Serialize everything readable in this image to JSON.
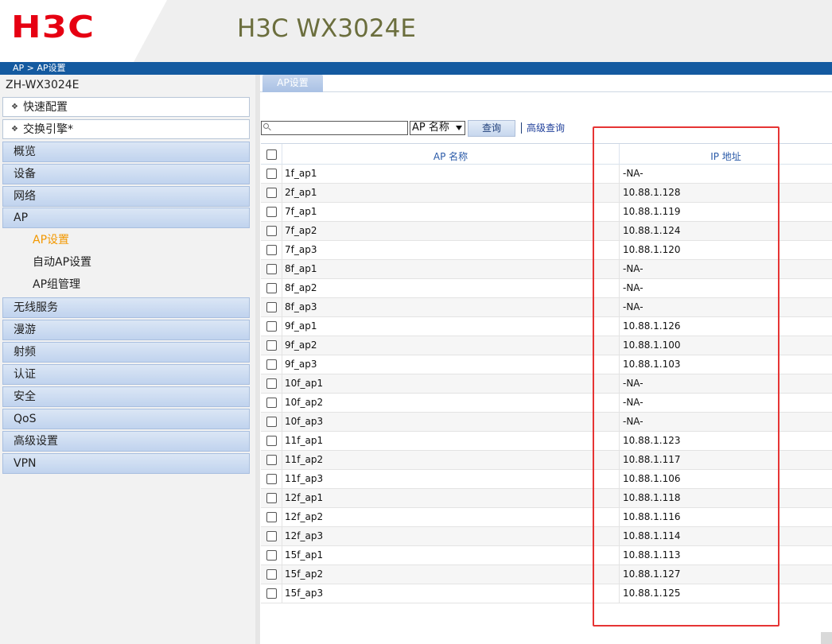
{
  "header": {
    "logo_text": "H3C",
    "product_title": "H3C WX3024E",
    "brand_color": "#e60012"
  },
  "breadcrumb": "AP > AP设置",
  "sidebar": {
    "device_name": "ZH-WX3024E",
    "quick_items": [
      "快速配置",
      "交换引擎*"
    ],
    "nav_group_top": [
      "概览",
      "设备",
      "网络",
      "AP"
    ],
    "ap_subitems": [
      {
        "label": "AP设置",
        "active": true
      },
      {
        "label": "自动AP设置",
        "active": false
      },
      {
        "label": "AP组管理",
        "active": false
      }
    ],
    "nav_group_bottom": [
      "无线服务",
      "漫游",
      "射频",
      "认证",
      "安全",
      "QoS",
      "高级设置",
      "VPN"
    ]
  },
  "tab": {
    "label": "AP设置"
  },
  "search": {
    "placeholder": "",
    "field_select": "AP 名称",
    "query_button": "查询",
    "advanced_link": "高级查询"
  },
  "table": {
    "columns": [
      "AP 名称",
      "IP 地址"
    ],
    "rows": [
      {
        "name": "1f_ap1",
        "ip": "-NA-"
      },
      {
        "name": "2f_ap1",
        "ip": "10.88.1.128"
      },
      {
        "name": "7f_ap1",
        "ip": "10.88.1.119"
      },
      {
        "name": "7f_ap2",
        "ip": "10.88.1.124"
      },
      {
        "name": "7f_ap3",
        "ip": "10.88.1.120"
      },
      {
        "name": "8f_ap1",
        "ip": "-NA-"
      },
      {
        "name": "8f_ap2",
        "ip": "-NA-"
      },
      {
        "name": "8f_ap3",
        "ip": "-NA-"
      },
      {
        "name": "9f_ap1",
        "ip": "10.88.1.126"
      },
      {
        "name": "9f_ap2",
        "ip": "10.88.1.100"
      },
      {
        "name": "9f_ap3",
        "ip": "10.88.1.103"
      },
      {
        "name": "10f_ap1",
        "ip": "-NA-"
      },
      {
        "name": "10f_ap2",
        "ip": "-NA-"
      },
      {
        "name": "10f_ap3",
        "ip": "-NA-"
      },
      {
        "name": "11f_ap1",
        "ip": "10.88.1.123"
      },
      {
        "name": "11f_ap2",
        "ip": "10.88.1.117"
      },
      {
        "name": "11f_ap3",
        "ip": "10.88.1.106"
      },
      {
        "name": "12f_ap1",
        "ip": "10.88.1.118"
      },
      {
        "name": "12f_ap2",
        "ip": "10.88.1.116"
      },
      {
        "name": "12f_ap3",
        "ip": "10.88.1.114"
      },
      {
        "name": "15f_ap1",
        "ip": "10.88.1.113"
      },
      {
        "name": "15f_ap2",
        "ip": "10.88.1.127"
      },
      {
        "name": "15f_ap3",
        "ip": "10.88.1.125"
      }
    ]
  },
  "highlight_color": "#e63434"
}
